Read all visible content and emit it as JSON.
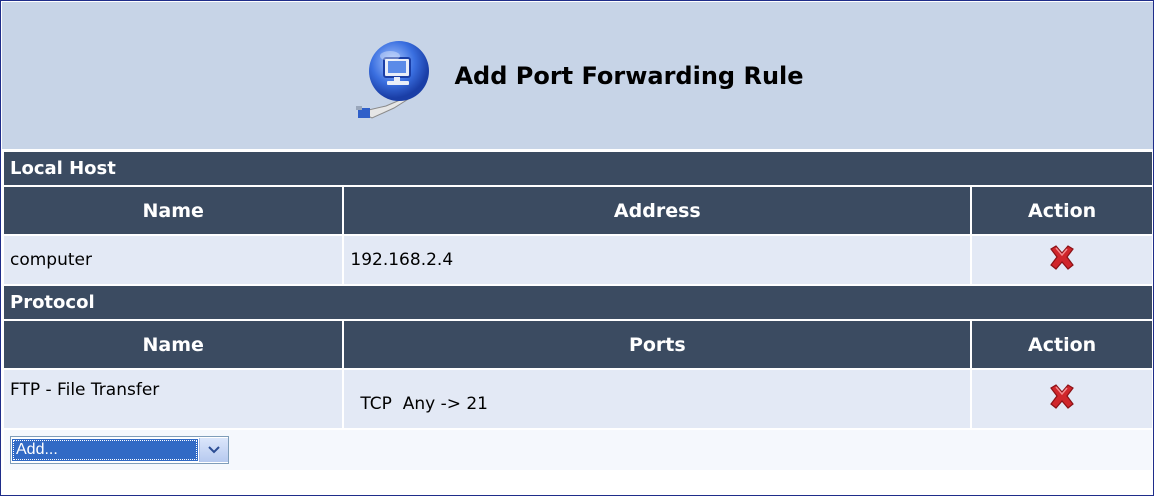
{
  "header": {
    "title": "Add Port Forwarding Rule",
    "icon": "network-computer-icon"
  },
  "local_host": {
    "section_label": "Local Host",
    "columns": [
      "Name",
      "Address",
      "Action"
    ],
    "rows": [
      {
        "name": "computer",
        "address": "192.168.2.4",
        "action_icon": "delete-icon"
      }
    ]
  },
  "protocol": {
    "section_label": "Protocol",
    "columns": [
      "Name",
      "Ports",
      "Action"
    ],
    "rows": [
      {
        "name": "FTP - File Transfer",
        "ports": "TCP  Any -> 21",
        "action_icon": "delete-icon"
      }
    ],
    "add_select": {
      "selected": "Add..."
    }
  },
  "colors": {
    "header_bg": "#c7d4e7",
    "section_bg": "#3b4b61",
    "row_bg": "#e3e9f5",
    "delete_red": "#d0262b",
    "select_highlight": "#316ac5"
  }
}
